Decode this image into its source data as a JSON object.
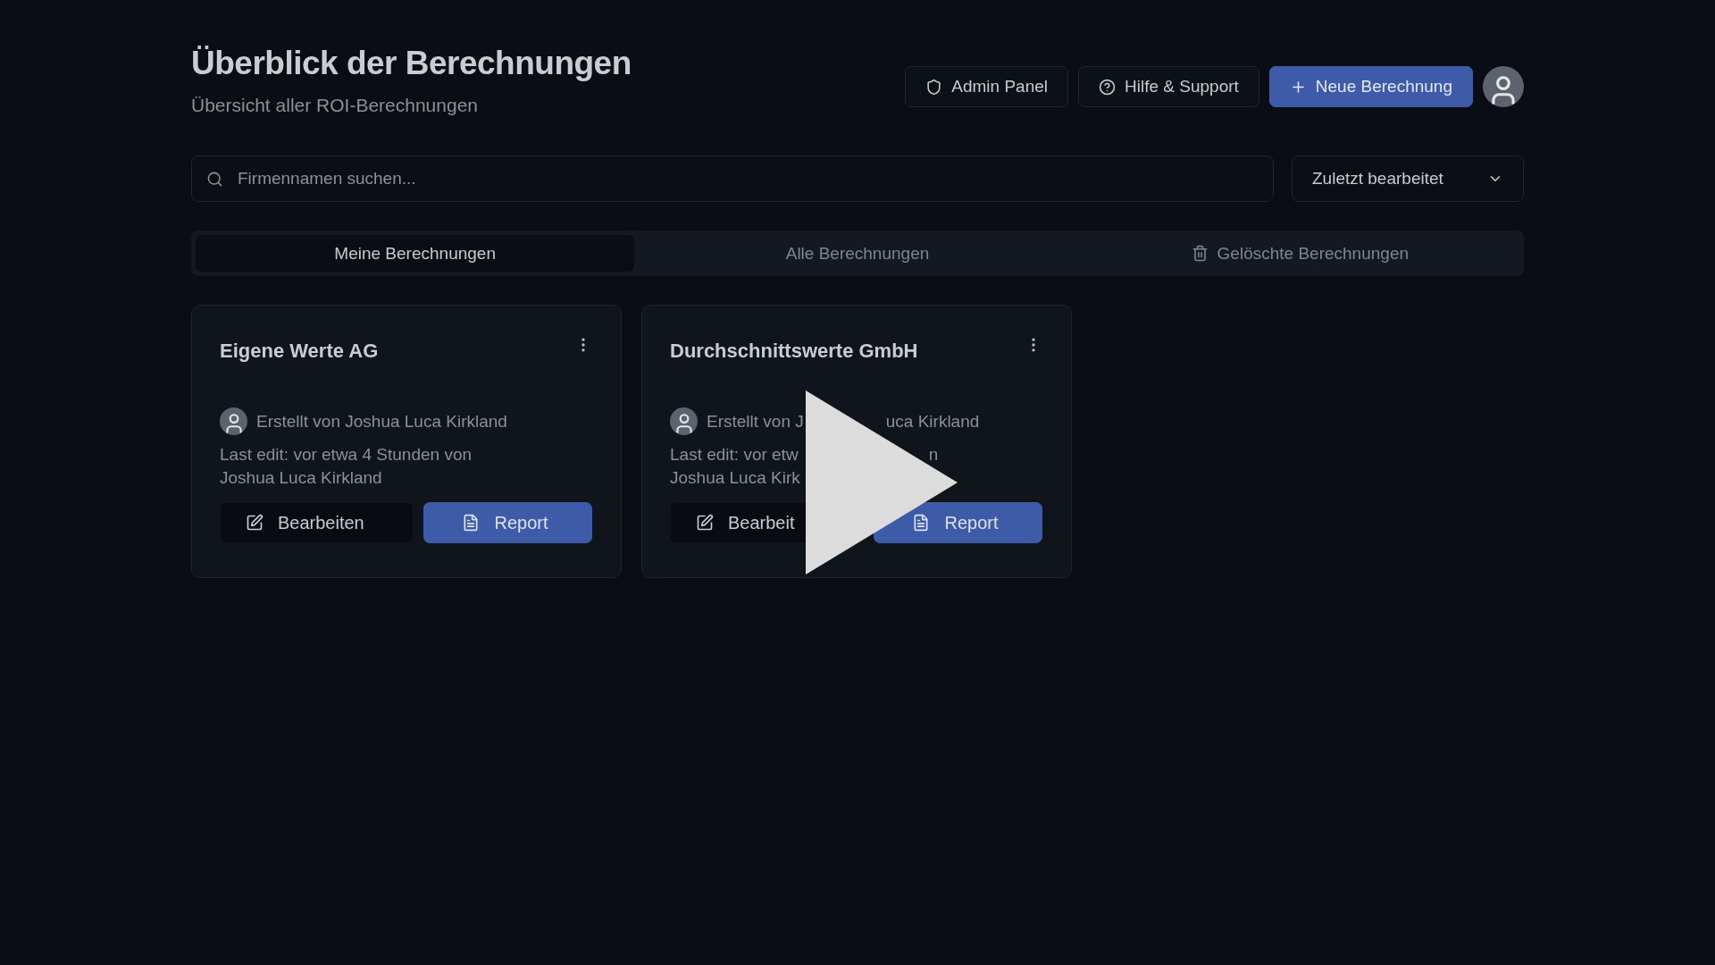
{
  "header": {
    "title": "Überblick der Berechnungen",
    "subtitle": "Übersicht aller ROI-Berechnungen"
  },
  "actions": [
    {
      "kind": "outline",
      "label": "Admin Panel"
    },
    {
      "kind": "outline",
      "label": "Hilfe & Support"
    },
    {
      "kind": "primary",
      "label": "Neue Berechnung"
    }
  ],
  "search": {
    "placeholder": "Firmennamen suchen..."
  },
  "sort": {
    "value": "Zuletzt bearbeitet"
  },
  "tabs": [
    {
      "label": "Meine Berechnungen",
      "selected": true
    },
    {
      "label": "Alle Berechnungen",
      "selected": false
    },
    {
      "label": "Gelöschte Berechnungen",
      "selected": false
    }
  ],
  "cards": [
    {
      "title": "Eigene Werte AG",
      "created_by": [
        "Erstellt von Joshua Luca Kirkland"
      ],
      "last_edit": [
        [
          "Last edit: vor etwa 4 Stunden von"
        ],
        [
          "Joshua Luca Kirkland"
        ]
      ],
      "edit_label": "Bearbeiten",
      "report_label": "Report"
    },
    {
      "title": "Durchschnittswerte GmbH",
      "created_by": [
        "Erstellt von J",
        "uca Kirkland"
      ],
      "last_edit": [
        [
          "Last edit: vor etw",
          "n"
        ],
        [
          "Joshua Luca Kirk"
        ]
      ],
      "edit_label": "Bearbeit",
      "report_label": "Report"
    }
  ]
}
